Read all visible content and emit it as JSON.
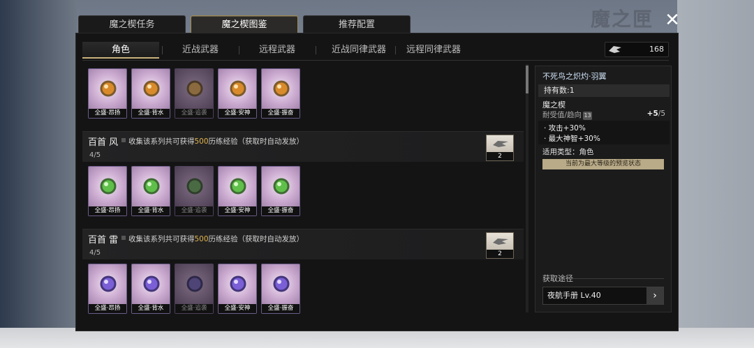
{
  "watermark": "魔之匣",
  "top_tabs": [
    "魔之楔任务",
    "魔之楔图鉴",
    "推荐配置"
  ],
  "sub_tabs": [
    "角色",
    "近战武器",
    "远程武器",
    "近战同律武器",
    "远程同律武器"
  ],
  "currency": {
    "icon": "wing-icon",
    "value": "168"
  },
  "item_names": [
    "全盛·昂扬",
    "全盛·背水",
    "全盛·追袭",
    "全盛·安神",
    "全盛·振奋"
  ],
  "series": [
    {
      "name": "百首 风",
      "desc_prefix": "收集该系列共可获得",
      "desc_amount": "500",
      "desc_suffix": "历练经验（获取时自动发放）",
      "progress": "4/5",
      "reward_count": "2"
    },
    {
      "name": "百首 雷",
      "desc_prefix": "收集该系列共可获得",
      "desc_amount": "500",
      "desc_suffix": "历练经验（获取时自动发放）",
      "progress": "4/5",
      "reward_count": "2"
    }
  ],
  "detail": {
    "title": "不死鸟之炽灼·羽翼",
    "owned": "持有数:1",
    "type": "魔之楔",
    "durability_label": "耐受值/趋向",
    "durability_badge": "13",
    "level_current": "+5",
    "level_max": "/5",
    "effects": [
      "· 攻击+30%",
      "· 最大神智+30%"
    ],
    "applicable": "适用类型：角色",
    "max_notice": "当前为最大等级的预览状态",
    "source_label": "获取途径",
    "source_value": "夜航手册 Lv.40"
  },
  "colors": {
    "accent_gold": "#c9b27a",
    "highlight": "#e3b64d",
    "gem_gold": "#d98a2b",
    "gem_green": "#5fbf4a",
    "gem_purple": "#7a5fd6"
  }
}
